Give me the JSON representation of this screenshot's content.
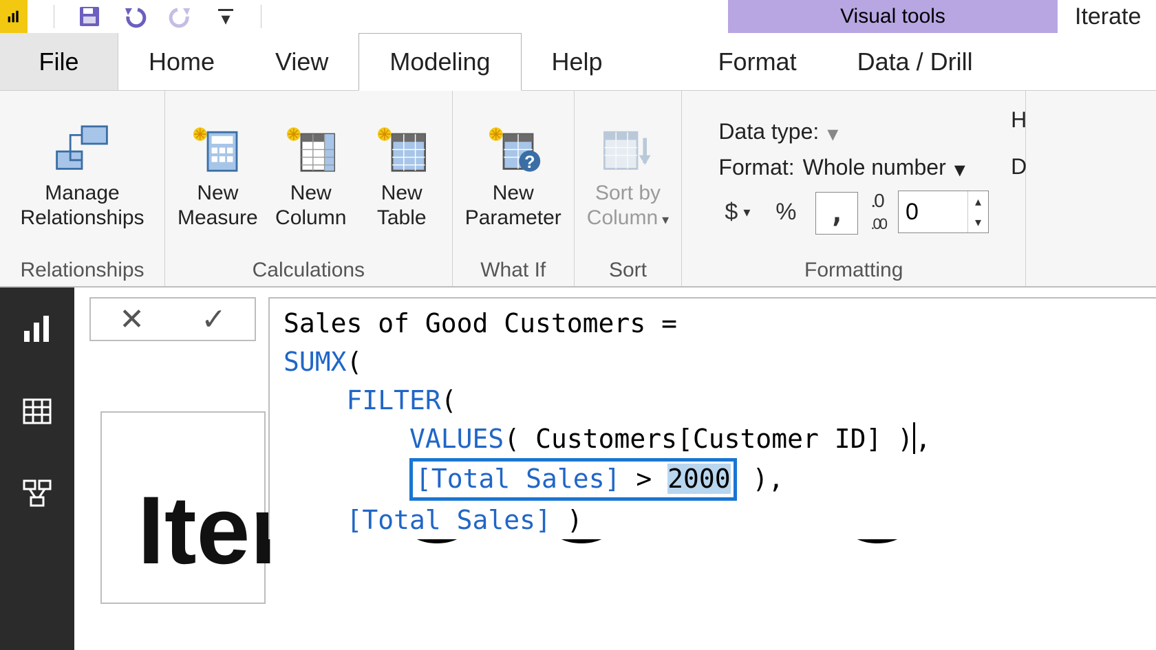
{
  "titlebar": {
    "visual_tools": "Visual tools",
    "file_title_fragment": "Iterate"
  },
  "tabs": {
    "file": "File",
    "home": "Home",
    "view": "View",
    "modeling": "Modeling",
    "help": "Help",
    "format": "Format",
    "data_drill": "Data / Drill"
  },
  "ribbon": {
    "relationships": {
      "manage": "Manage\nRelationships",
      "group_label": "Relationships"
    },
    "calculations": {
      "new_measure": "New\nMeasure",
      "new_column": "New\nColumn",
      "new_table": "New\nTable",
      "group_label": "Calculations"
    },
    "whatif": {
      "new_parameter": "New\nParameter",
      "group_label": "What If"
    },
    "sort": {
      "sort_by_column": "Sort by\nColumn",
      "group_label": "Sort"
    },
    "formatting": {
      "data_type_label": "Data type:",
      "format_label": "Format:",
      "format_value": "Whole number",
      "decimals": "0",
      "group_label": "Formatting",
      "right_edge_top": "H",
      "right_edge_bottom": "D"
    }
  },
  "formula": {
    "measure_name": "Sales of Good Customers",
    "fn_sumx": "SUMX",
    "fn_filter": "FILTER",
    "fn_values": "VALUES",
    "table_col": "Customers[Customer ID]",
    "bracket_total_sales": "[Total Sales]",
    "threshold": "2000"
  },
  "canvas": {
    "bg_text": "Iter"
  }
}
